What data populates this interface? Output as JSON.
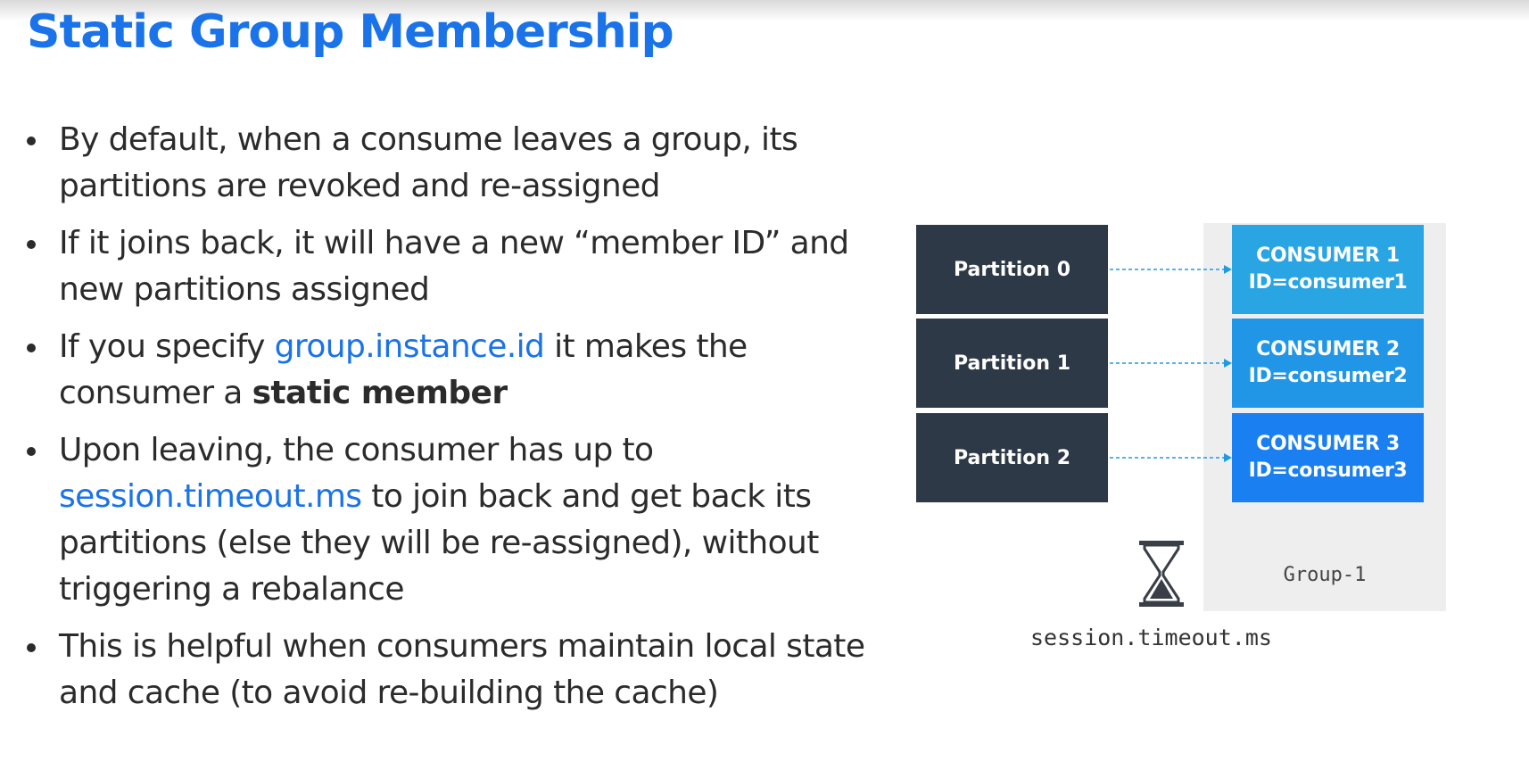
{
  "slide": {
    "title": "Static Group Membership",
    "bullets": [
      {
        "text": "By default, when a consume leaves a group, its partitions are revoked and re-assigned"
      },
      {
        "text": "If it joins back, it will have a new “member ID” and new partitions assigned"
      },
      {
        "before": "If you specify ",
        "code": "group.instance.id",
        "middle": " it makes the consumer a ",
        "strong": "static member"
      },
      {
        "before": "Upon leaving, the consumer has up to ",
        "code": "session.timeout.ms",
        "after": " to join back and get back its partitions (else they will be re-assigned), without triggering a rebalance"
      },
      {
        "text": "This is helpful when consumers maintain local state and cache (to avoid re-building the cache)"
      }
    ]
  },
  "diagram": {
    "partitions": [
      "Partition 0",
      "Partition 1",
      "Partition 2"
    ],
    "consumers": [
      {
        "name": "CONSUMER 1",
        "id": "ID=consumer1",
        "color": "#2aa5e3"
      },
      {
        "name": "CONSUMER 2",
        "id": "ID=consumer2",
        "color": "#2196e6"
      },
      {
        "name": "CONSUMER 3",
        "id": "ID=consumer3",
        "color": "#1a7ff0"
      }
    ],
    "group_label": "Group-1",
    "timer_label": "session.timeout.ms",
    "timer_icon": "hourglass-icon",
    "arrow_color": "#1d9be0",
    "partition_color": "#2e3947",
    "group_background": "#eeeeef"
  },
  "colors": {
    "title": "#1a73e8",
    "code": "#1a73e8",
    "text": "#2b2b2b"
  }
}
